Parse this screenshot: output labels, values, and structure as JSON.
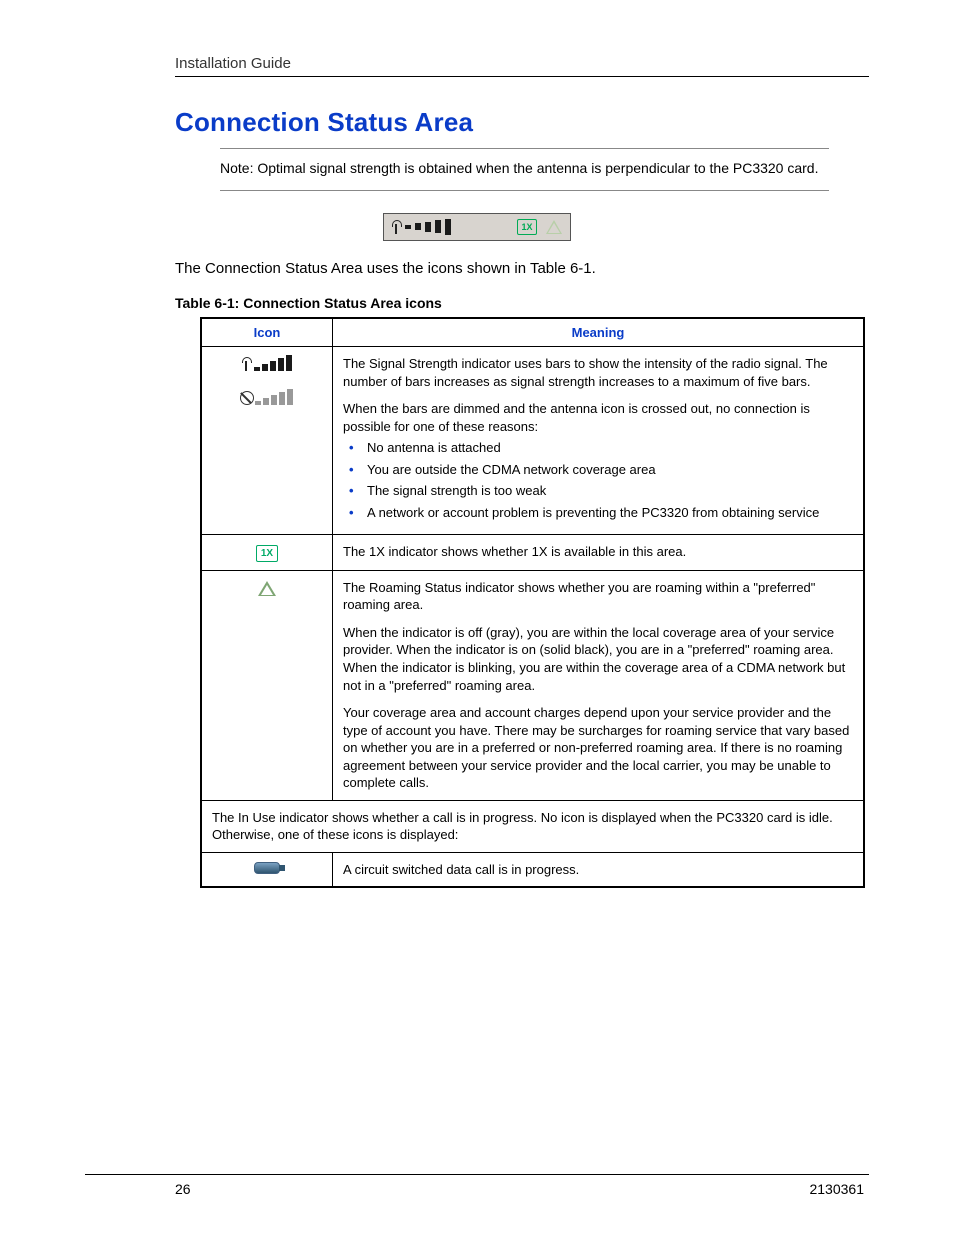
{
  "header": {
    "running_title": "Installation Guide"
  },
  "section": {
    "title": "Connection Status Area"
  },
  "note": {
    "text": "Note:  Optimal signal strength is obtained when the antenna is perpendicular to the PC3320 card."
  },
  "intro": "The Connection Status Area uses the icons shown in Table 6-1.",
  "table": {
    "caption": "Table 6-1: Connection Status Area icons",
    "headers": {
      "icon": "Icon",
      "meaning": "Meaning"
    },
    "rows": {
      "signal": {
        "p1": "The Signal Strength indicator uses bars to show the intensity of the radio signal. The number of bars increases as signal strength increases to a maximum of five bars.",
        "p2": "When the bars are dimmed and the antenna icon is crossed out, no connection is possible for one of these reasons:",
        "bullets": [
          "No antenna is attached",
          "You are outside the CDMA network coverage area",
          "The signal strength is too weak",
          "A network or account problem is preventing the PC3320 from obtaining service"
        ]
      },
      "onex": "The 1X indicator shows whether 1X is available in this area.",
      "roam": {
        "p1": "The Roaming Status indicator shows whether you are roaming within a \"preferred\" roaming area.",
        "p2": "When the indicator is off (gray), you are within the local coverage area of your service provider. When the indicator is on (solid black), you are in a \"preferred\" roaming area. When the indicator is blinking, you are within the coverage area of a CDMA network but not in a \"preferred\" roaming area.",
        "p3": "Your coverage area and account charges depend upon your service provider and the type of account you have. There may be surcharges for roaming service that vary based on whether you are in a preferred or non-preferred roaming area. If there is no roaming agreement between your service provider and the local carrier, you may be unable to complete calls."
      },
      "inuse_intro": "The In Use indicator shows whether a call is in progress. No icon is displayed when the PC3320 card is idle. Otherwise, one of these icons is displayed:",
      "csd": "A circuit switched data call is in progress."
    }
  },
  "footer": {
    "page": "26",
    "docnum": "2130361"
  },
  "icons": {
    "onex_label": "1X"
  }
}
